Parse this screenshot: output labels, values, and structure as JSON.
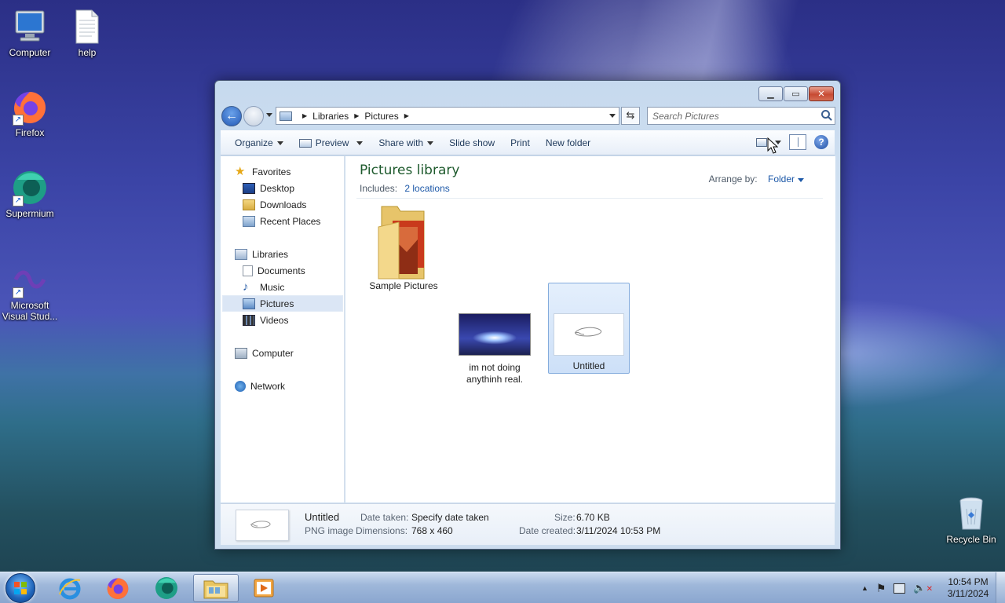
{
  "desktop": {
    "icons": [
      {
        "label": "Computer",
        "icon": "computer-icon"
      },
      {
        "label": "help",
        "icon": "text-document-icon"
      },
      {
        "label": "Firefox",
        "icon": "firefox-icon"
      },
      {
        "label": "Supermium",
        "icon": "supermium-icon"
      },
      {
        "label": "Microsoft Visual Stud...",
        "icon": "visual-studio-icon"
      },
      {
        "label": "Recycle Bin",
        "icon": "recycle-bin-icon"
      }
    ]
  },
  "window": {
    "breadcrumb": [
      "Libraries",
      "Pictures"
    ],
    "search_placeholder": "Search Pictures",
    "toolbar": {
      "organize": "Organize",
      "preview": "Preview",
      "share_with": "Share with",
      "slide_show": "Slide show",
      "print": "Print",
      "new_folder": "New folder"
    },
    "nav": {
      "favorites": "Favorites",
      "desktop": "Desktop",
      "downloads": "Downloads",
      "recent_places": "Recent Places",
      "libraries": "Libraries",
      "documents": "Documents",
      "music": "Music",
      "pictures": "Pictures",
      "videos": "Videos",
      "computer": "Computer",
      "network": "Network",
      "selected": "Pictures"
    },
    "library": {
      "title": "Pictures library",
      "includes_label": "Includes:",
      "locations": "2 locations",
      "arrange_by_label": "Arrange by:",
      "arrange_by_value": "Folder"
    },
    "items": [
      {
        "name": "Sample Pictures",
        "type": "folder"
      },
      {
        "name_line1": "im not doing",
        "name_line2": "anythinh real.",
        "type": "image"
      },
      {
        "name": "Untitled",
        "type": "image",
        "selected": true
      }
    ],
    "details": {
      "name": "Untitled",
      "type": "PNG image",
      "date_taken_label": "Date taken:",
      "date_taken_value": "Specify date taken",
      "dimensions_label": "Dimensions:",
      "dimensions_value": "768 x 460",
      "size_label": "Size:",
      "size_value": "6.70 KB",
      "date_created_label": "Date created:",
      "date_created_value": "3/11/2024 10:53 PM"
    }
  },
  "taskbar": {
    "pinned": [
      "start-button",
      "internet-explorer-icon",
      "firefox-icon",
      "supermium-icon",
      "windows-explorer-icon",
      "media-player-icon"
    ],
    "time": "10:54 PM",
    "date": "3/11/2024"
  },
  "colors": {
    "library_title": "#1e5a2d",
    "link": "#1c58a8",
    "selection": "#cde0f8"
  }
}
